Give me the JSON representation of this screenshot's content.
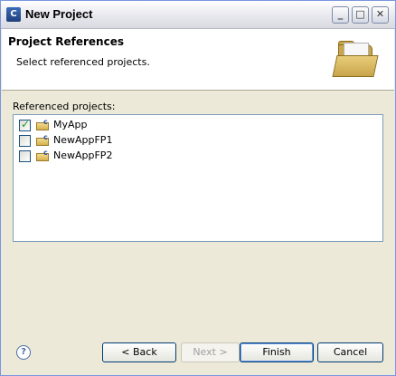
{
  "window": {
    "title": "New Project",
    "minimize": "_",
    "maximize": "□",
    "close": "✕"
  },
  "header": {
    "title": "Project References",
    "description": "Select referenced projects.",
    "icon": "folder-open-icon"
  },
  "references": {
    "label": "Referenced projects:",
    "items": [
      {
        "label": "MyApp",
        "checked": true
      },
      {
        "label": "NewAppFP1",
        "checked": false
      },
      {
        "label": "NewAppFP2",
        "checked": false
      }
    ]
  },
  "footer": {
    "help": "?",
    "back": "< Back",
    "next": "Next >",
    "finish": "Finish",
    "cancel": "Cancel"
  }
}
